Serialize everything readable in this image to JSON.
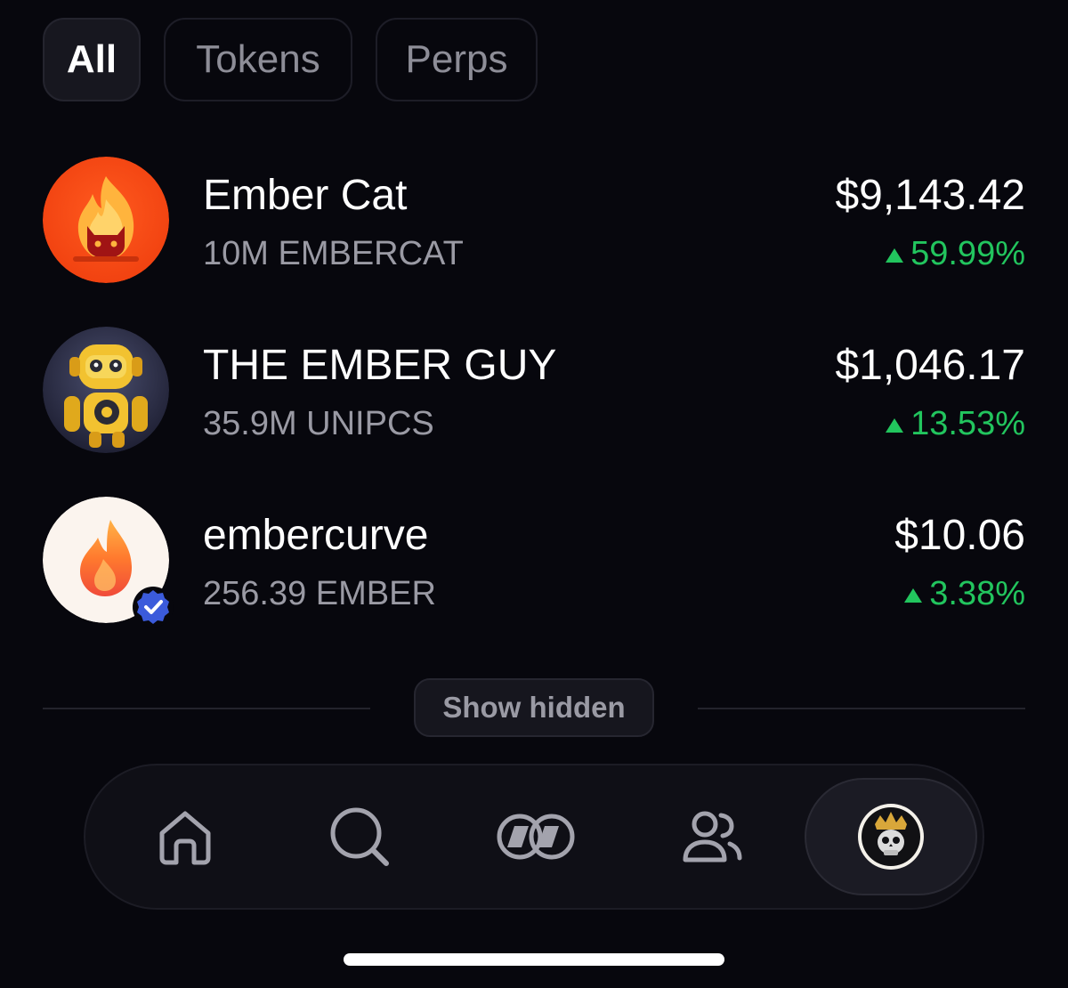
{
  "tabs": [
    {
      "label": "All",
      "active": true
    },
    {
      "label": "Tokens",
      "active": false
    },
    {
      "label": "Perps",
      "active": false
    }
  ],
  "assets": [
    {
      "name": "Ember Cat",
      "holding": "10M EMBERCAT",
      "value": "$9,143.42",
      "change": "59.99%",
      "direction": "up",
      "avatar_icon": "ember-cat-flame-icon",
      "verified": false
    },
    {
      "name": "THE EMBER GUY",
      "holding": "35.9M UNIPCS",
      "value": "$1,046.17",
      "change": "13.53%",
      "direction": "up",
      "avatar_icon": "yellow-robot-icon",
      "verified": false
    },
    {
      "name": "embercurve",
      "holding": "256.39 EMBER",
      "value": "$10.06",
      "change": "3.38%",
      "direction": "up",
      "avatar_icon": "orange-flame-icon",
      "verified": true
    }
  ],
  "show_hidden_label": "Show hidden",
  "nav": {
    "items": [
      {
        "icon": "home-icon"
      },
      {
        "icon": "search-icon"
      },
      {
        "icon": "trade-icon"
      },
      {
        "icon": "friends-icon"
      },
      {
        "icon": "skull-crown-avatar-icon",
        "active": true
      }
    ]
  },
  "colors": {
    "background": "#07070d",
    "positive": "#22c55e",
    "muted_text": "#9a9aa4",
    "verified_badge": "#3b5bdb"
  }
}
